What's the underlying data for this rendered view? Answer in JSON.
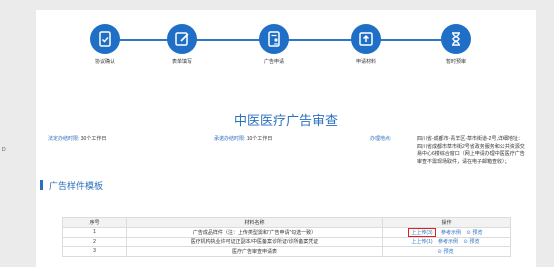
{
  "left_edge_text": "D",
  "steps": [
    {
      "label": "协议确认",
      "icon": "document-check-icon"
    },
    {
      "label": "表单填写",
      "icon": "pen-edit-icon"
    },
    {
      "label": "广告申请",
      "icon": "person-document-icon"
    },
    {
      "label": "申请材料",
      "icon": "upload-tray-icon"
    },
    {
      "label": "暂时预审",
      "icon": "hourglass-icon"
    }
  ],
  "title": "中医医疗广告审查",
  "info": {
    "legal_label": "法定办结时限:",
    "legal_value": "30个工作日",
    "promise_label": "承诺办结时限:",
    "promise_value": "10个工作日",
    "place_label": "办理地点:",
    "place_value": "四川省-成都市-青羊区-草市街道-2号,详细地址：四川省成都市草市街2号省政务服务和公共资源交易中心6楼综合窗口（网上申请办理中医医疗广告审查不需现场取件，请在电子邮箱查收）；"
  },
  "section_title": "广告样件模板",
  "table": {
    "headers": [
      "序号",
      "材料名称",
      "操作"
    ],
    "rows": [
      {
        "no": "1",
        "name": "广告成品样件（注：上传类型需和“广告申请”勾选一致）",
        "actions": [
          "上上传(3)",
          "参考示例",
          "预览"
        ]
      },
      {
        "no": "2",
        "name": "医疗机构执业许可证正副本/中医备案诊所证/诊所备案凭证",
        "actions": [
          "上上传(1)",
          "参考示例",
          "预览"
        ]
      },
      {
        "no": "3",
        "name": "医疗广告审查申请表",
        "actions": [
          "预览"
        ]
      }
    ]
  },
  "colors": {
    "accent": "#2c6fbf",
    "highlight": "#e02020"
  }
}
